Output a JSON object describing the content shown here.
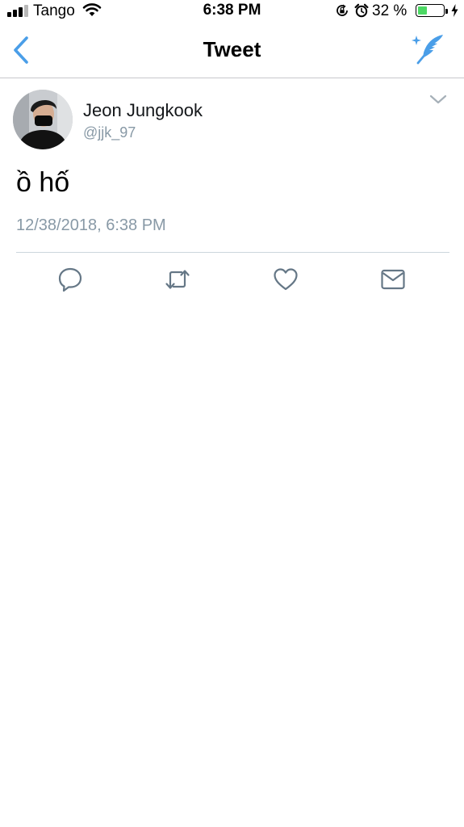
{
  "status_bar": {
    "carrier": "Tango",
    "time": "6:38 PM",
    "battery_percent": "32 %",
    "battery_level": 0.32,
    "battery_color": "#4cd964"
  },
  "nav": {
    "title": "Tweet",
    "back_icon": "chevron-left-icon",
    "compose_icon": "compose-tweet-icon",
    "accent_color": "#4a9ee8"
  },
  "tweet": {
    "display_name": "Jeon Jungkook",
    "handle": "@jjk_97",
    "text": "ồ hố",
    "timestamp": "12/38/2018, 6:38 PM",
    "actions": [
      "reply-icon",
      "retweet-icon",
      "like-icon",
      "message-icon"
    ],
    "action_color": "#657786"
  }
}
